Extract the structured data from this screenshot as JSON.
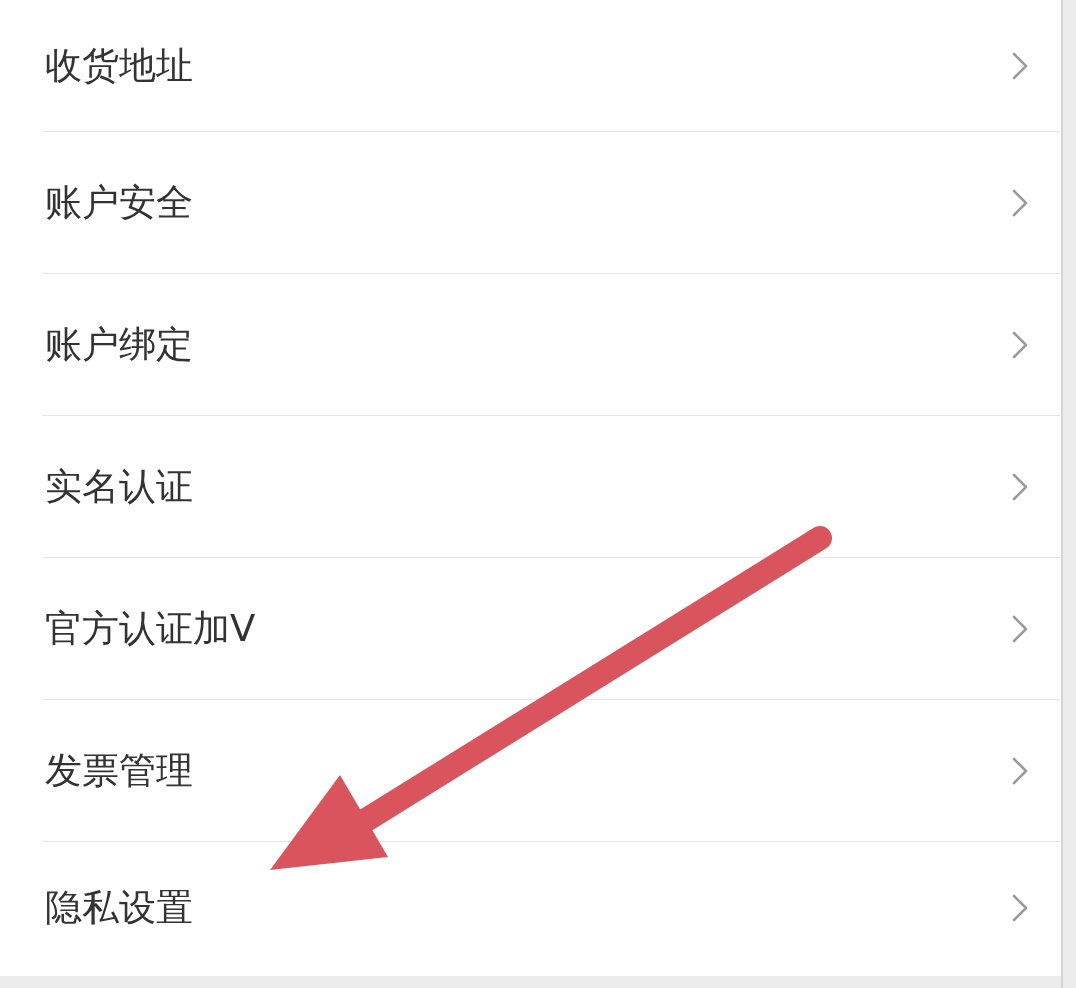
{
  "settings_items": [
    {
      "label": "收货地址"
    },
    {
      "label": "账户安全"
    },
    {
      "label": "账户绑定"
    },
    {
      "label": "实名认证"
    },
    {
      "label": "官方认证加V"
    },
    {
      "label": "发票管理"
    },
    {
      "label": "隐私设置"
    }
  ]
}
